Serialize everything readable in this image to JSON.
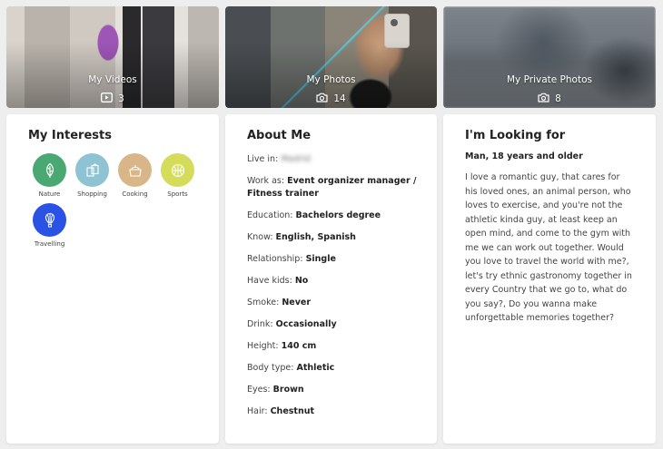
{
  "media": {
    "videos": {
      "label": "My Videos",
      "count": "3"
    },
    "photos": {
      "label": "My Photos",
      "count": "14"
    },
    "private": {
      "label": "My Private Photos",
      "count": "8"
    }
  },
  "interests": {
    "title": "My Interests",
    "items": [
      {
        "label": "Nature",
        "icon": "leaf-icon",
        "color": "#4aa872"
      },
      {
        "label": "Shopping",
        "icon": "shopping-bags-icon",
        "color": "#8ec3d3"
      },
      {
        "label": "Cooking",
        "icon": "cooking-pot-icon",
        "color": "#d9b687"
      },
      {
        "label": "Sports",
        "icon": "ball-icon",
        "color": "#d4dc5a"
      },
      {
        "label": "Travelling",
        "icon": "hot-air-balloon-icon",
        "color": "#2a53e6"
      }
    ]
  },
  "about": {
    "title": "About Me",
    "rows": [
      {
        "key": "Live in:",
        "value": "Madrid",
        "blurred": true
      },
      {
        "key": "Work as:",
        "value": "Event organizer manager / Fitness trainer"
      },
      {
        "key": "Education:",
        "value": "Bachelors degree"
      },
      {
        "key": "Know:",
        "value": "English, Spanish"
      },
      {
        "key": "Relationship:",
        "value": "Single"
      },
      {
        "key": "Have kids:",
        "value": "No"
      },
      {
        "key": "Smoke:",
        "value": "Never"
      },
      {
        "key": "Drink:",
        "value": "Occasionally"
      },
      {
        "key": "Height:",
        "value": "140 cm"
      },
      {
        "key": "Body type:",
        "value": "Athletic"
      },
      {
        "key": "Eyes:",
        "value": "Brown"
      },
      {
        "key": "Hair:",
        "value": "Chestnut"
      }
    ]
  },
  "looking": {
    "title": "I'm Looking for",
    "subtitle": "Man, 18 years and older",
    "text": "I love a romantic guy, that cares for his loved ones, an animal person, who loves to exercise, and you're not the athletic kinda guy, at least keep an open mind, and come to the gym with me we can work out together. Would you love to travel the world with me?, let's try ethnic gastronomy together in every Country that we go to, what do you say?, Do you wanna make unforgettable memories together?"
  }
}
